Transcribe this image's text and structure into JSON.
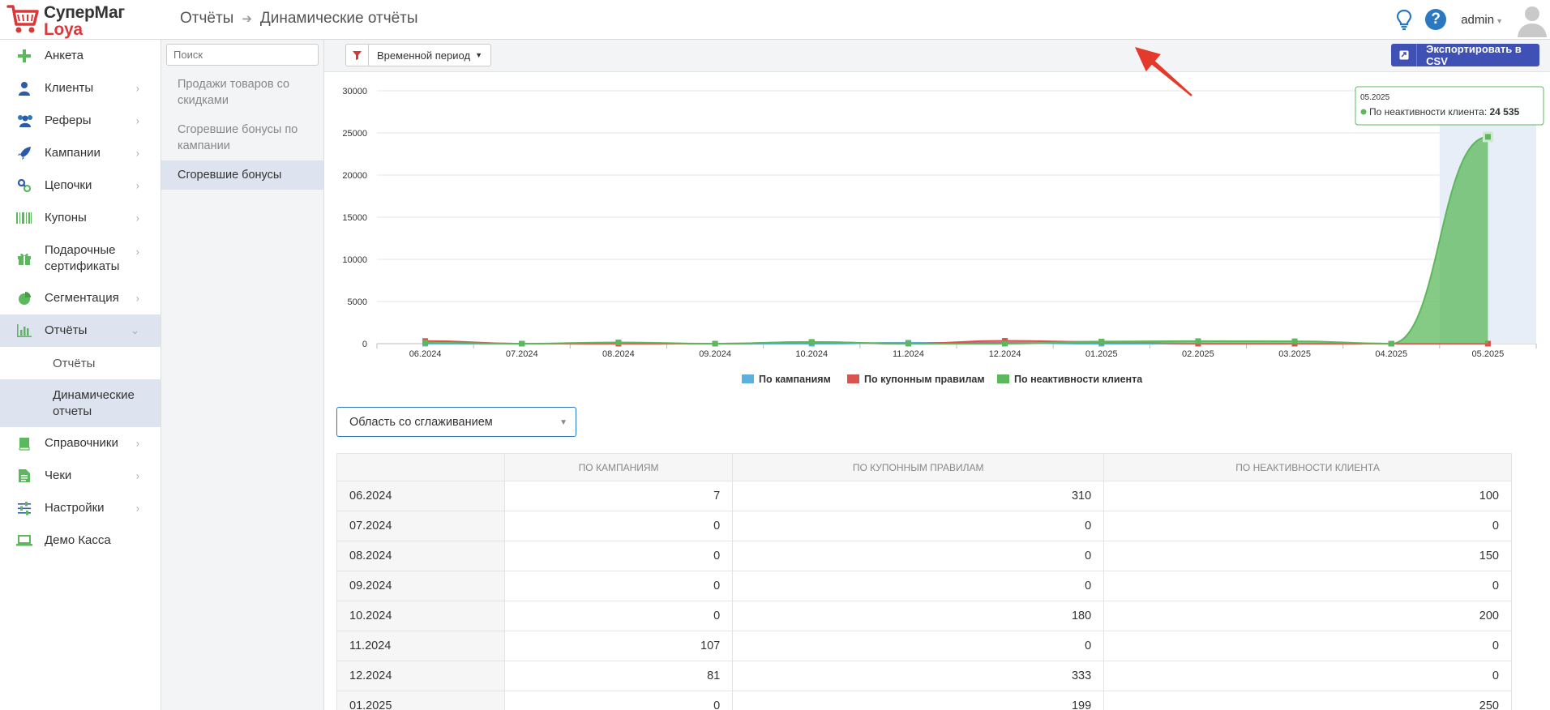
{
  "app": {
    "logo_line1": "СуперМаг",
    "logo_line2": "Loya",
    "brand_red": "#d9383a"
  },
  "breadcrumb": {
    "parent": "Отчёты",
    "current": "Динамические отчёты"
  },
  "header": {
    "user": "admin"
  },
  "sidebar": {
    "items": [
      {
        "label": "Анкета",
        "icon": "plus-icon"
      },
      {
        "label": "Клиенты",
        "icon": "user-icon"
      },
      {
        "label": "Реферы",
        "icon": "users-icon"
      },
      {
        "label": "Кампании",
        "icon": "rocket-icon"
      },
      {
        "label": "Цепочки",
        "icon": "link-icon"
      },
      {
        "label": "Купоны",
        "icon": "barcode-icon"
      },
      {
        "label": "Подарочные сертификаты",
        "icon": "gift-icon"
      },
      {
        "label": "Сегментация",
        "icon": "pie-chart-icon"
      },
      {
        "label": "Отчёты",
        "icon": "bar-chart-icon"
      },
      {
        "label": "Справочники",
        "icon": "book-icon"
      },
      {
        "label": "Чеки",
        "icon": "receipt-icon"
      },
      {
        "label": "Настройки",
        "icon": "sliders-icon"
      },
      {
        "label": "Демо Касса",
        "icon": "laptop-icon"
      }
    ],
    "sub_items": [
      {
        "label": "Отчёты"
      },
      {
        "label": "Динамические отчеты"
      }
    ]
  },
  "panel": {
    "search_placeholder": "Поиск",
    "items": [
      {
        "label": "Продажи товаров со скидками"
      },
      {
        "label": "Сгоревшие бонусы по кампании"
      },
      {
        "label": "Сгоревшие бонусы"
      }
    ]
  },
  "toolbar": {
    "period_label": "Временной период",
    "export_label": "Экспортировать в CSV"
  },
  "tooltip": {
    "title": "05.2025",
    "series": "По неактивности клиента",
    "value": "24 535"
  },
  "chart_data": {
    "type": "area",
    "categories": [
      "06.2024",
      "07.2024",
      "08.2024",
      "09.2024",
      "10.2024",
      "11.2024",
      "12.2024",
      "01.2025",
      "02.2025",
      "03.2025",
      "04.2025",
      "05.2025"
    ],
    "y_ticks": [
      "0",
      "5000",
      "10000",
      "15000",
      "20000",
      "25000",
      "30000"
    ],
    "ylim": [
      0,
      30000
    ],
    "grid": true,
    "legend_position": "bottom-center",
    "series": [
      {
        "name": "По кампаниям",
        "color": "#5bb0dd",
        "values": [
          7,
          0,
          0,
          0,
          0,
          107,
          81,
          0,
          0,
          0,
          0,
          0
        ]
      },
      {
        "name": "По купонным правилам",
        "color": "#d9534f",
        "values": [
          310,
          0,
          0,
          0,
          180,
          0,
          333,
          199,
          0,
          0,
          0,
          0
        ]
      },
      {
        "name": "По неактивности клиента",
        "color": "#5cb85c",
        "values": [
          100,
          0,
          150,
          0,
          200,
          0,
          0,
          250,
          300,
          280,
          0,
          24535
        ]
      }
    ]
  },
  "chart_type_select": "Область со сглаживанием",
  "table": {
    "headers": [
      "По кампаниям",
      "По купонным правилам",
      "По неактивности клиента"
    ],
    "rows": [
      {
        "label": "06.2024",
        "a": "7",
        "b": "310",
        "c": "100"
      },
      {
        "label": "07.2024",
        "a": "0",
        "b": "0",
        "c": "0"
      },
      {
        "label": "08.2024",
        "a": "0",
        "b": "0",
        "c": "150"
      },
      {
        "label": "09.2024",
        "a": "0",
        "b": "0",
        "c": "0"
      },
      {
        "label": "10.2024",
        "a": "0",
        "b": "180",
        "c": "200"
      },
      {
        "label": "11.2024",
        "a": "107",
        "b": "0",
        "c": "0"
      },
      {
        "label": "12.2024",
        "a": "81",
        "b": "333",
        "c": "0"
      },
      {
        "label": "01.2025",
        "a": "0",
        "b": "199",
        "c": "250"
      }
    ]
  }
}
